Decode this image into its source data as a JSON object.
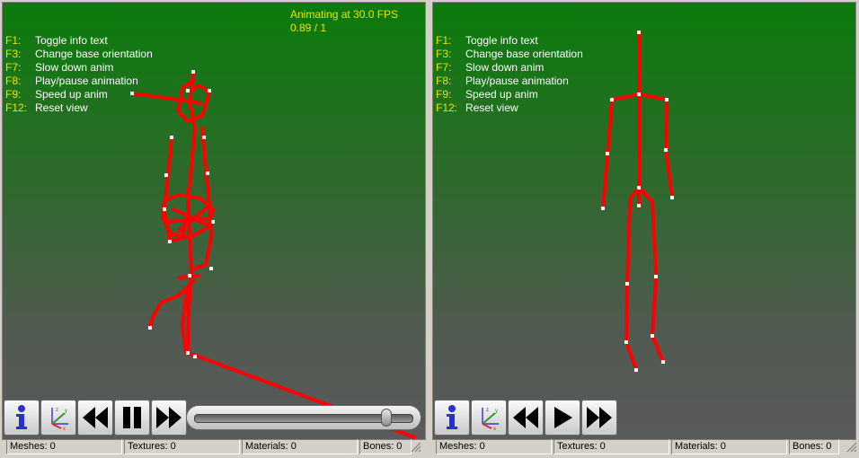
{
  "left_view": {
    "fps_text": "Animating at 30.0 FPS",
    "frame_text": "0.89 / 1",
    "info": [
      {
        "key": "F1:",
        "label": "Toggle info text"
      },
      {
        "key": "F3:",
        "label": "Change base orientation"
      },
      {
        "key": "F7:",
        "label": "Slow down anim"
      },
      {
        "key": "F8:",
        "label": "Play/pause animation"
      },
      {
        "key": "F9:",
        "label": "Speed up anim"
      },
      {
        "key": "F12:",
        "label": "Reset view"
      }
    ],
    "toolbar": {
      "info_icon": "info-icon",
      "axes_icon": "axes-icon",
      "rewind_icon": "rewind-icon",
      "pause_icon": "pause-icon",
      "forward_icon": "fast-forward-icon"
    },
    "playback_progress": 0.89
  },
  "right_view": {
    "info": [
      {
        "key": "F1:",
        "label": "Toggle info text"
      },
      {
        "key": "F3:",
        "label": "Change base orientation"
      },
      {
        "key": "F7:",
        "label": "Slow down anim"
      },
      {
        "key": "F8:",
        "label": "Play/pause animation"
      },
      {
        "key": "F9:",
        "label": "Speed up anim"
      },
      {
        "key": "F12:",
        "label": "Reset view"
      }
    ],
    "toolbar": {
      "info_icon": "info-icon",
      "axes_icon": "axes-icon",
      "rewind_icon": "rewind-icon",
      "play_icon": "play-icon",
      "forward_icon": "fast-forward-icon"
    }
  },
  "status_left": {
    "meshes": "Meshes: 0",
    "textures": "Textures: 0",
    "materials": "Materials: 0",
    "bones": "Bones: 0"
  },
  "status_right": {
    "meshes": "Meshes: 0",
    "textures": "Textures: 0",
    "materials": "Materials: 0",
    "bones": "Bones: 0"
  },
  "colors": {
    "bone": "#ff0000",
    "info_key": "#e5e500",
    "info_text": "#ffffff",
    "bg_top": "#0b7b0b",
    "bg_bottom": "#5a5a5a"
  }
}
